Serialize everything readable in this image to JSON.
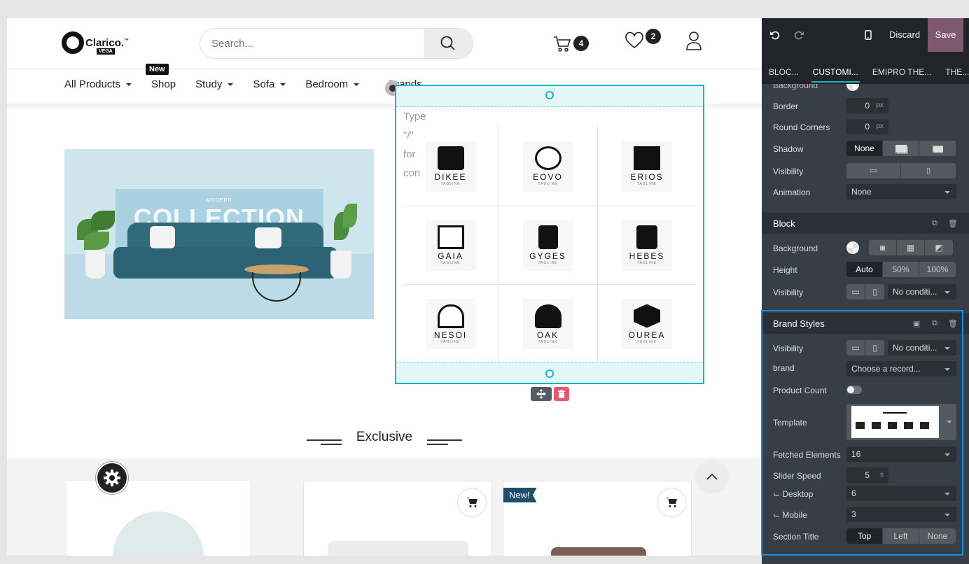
{
  "header": {
    "logo_text": "Clarico.",
    "logo_tm": "™",
    "logo_sub": "VEGA",
    "search_placeholder": "Search...",
    "cart_count": "4",
    "wishlist_count": "2"
  },
  "nav": {
    "new_badge": "New",
    "items": [
      {
        "label": "All Products",
        "caret": true
      },
      {
        "label": "Shop",
        "caret": false
      },
      {
        "label": "Study",
        "caret": true
      },
      {
        "label": "Sofa",
        "caret": true
      },
      {
        "label": "Bedroom",
        "caret": true
      },
      {
        "label": "Brands",
        "caret": false
      }
    ]
  },
  "banner": {
    "modern": "MODERN",
    "collection": "COLLECTION"
  },
  "snippet": {
    "type_hint": [
      "Type",
      "\"/\"",
      "for",
      "con"
    ],
    "brands": [
      {
        "name": "DIKEE",
        "tagline": "TAGLINE"
      },
      {
        "name": "EOVO",
        "tagline": "TAGLINE"
      },
      {
        "name": "ERIOS",
        "tagline": "TAGLINE"
      },
      {
        "name": "GAIA",
        "tagline": "TAGLINE"
      },
      {
        "name": "GYGES",
        "tagline": "TAGLINE"
      },
      {
        "name": "HEBES",
        "tagline": "TAGLINE"
      },
      {
        "name": "NESOI",
        "tagline": "TAGLINE"
      },
      {
        "name": "OAK",
        "tagline": "TAGLINE"
      },
      {
        "name": "OUREA",
        "tagline": "TAGLINE"
      }
    ]
  },
  "exclusive": {
    "title": "Exclusive",
    "new_tag": "New!"
  },
  "editor": {
    "discard": "Discard",
    "save": "Save",
    "tabs": [
      "BLOC...",
      "CUSTOMI...",
      "EMIPRO THE...",
      "THE..."
    ],
    "top_section": {
      "background_label": "Background",
      "border_label": "Border",
      "border_value": "0",
      "border_unit": "px",
      "round_label": "Round Corners",
      "round_value": "0",
      "round_unit": "px",
      "shadow_label": "Shadow",
      "shadow_none": "None",
      "visibility_label": "Visibility",
      "animation_label": "Animation",
      "animation_value": "None"
    },
    "block": {
      "title": "Block",
      "background_label": "Background",
      "height_label": "Height",
      "height_options": [
        "Auto",
        "50%",
        "100%"
      ],
      "visibility_label": "Visibility",
      "visibility_value": "No conditi..."
    },
    "brand_styles": {
      "title": "Brand Styles",
      "visibility_label": "Visibility",
      "visibility_value": "No conditi...",
      "brand_label": "brand",
      "brand_value": "Choose a record...",
      "product_count_label": "Product Count",
      "template_label": "Template",
      "fetched_label": "Fetched Elements",
      "fetched_value": "16",
      "slider_label": "Slider Speed",
      "slider_value": "5",
      "slider_unit": "s",
      "desktop_label": "⌙ Desktop",
      "desktop_value": "6",
      "mobile_label": "⌙ Mobile",
      "mobile_value": "3",
      "section_title_label": "Section Title",
      "section_title_options": [
        "Top",
        "Left",
        "None"
      ]
    }
  }
}
